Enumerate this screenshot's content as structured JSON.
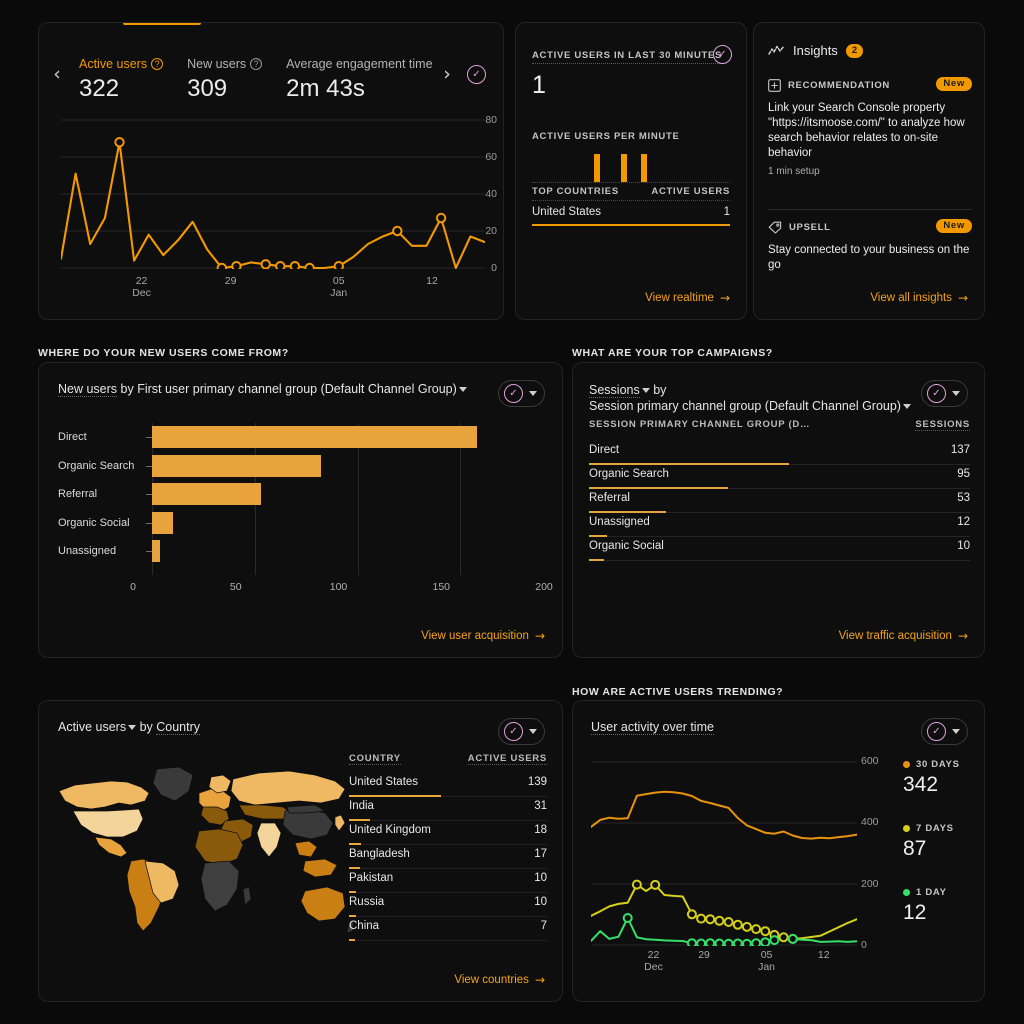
{
  "metrics_card": {
    "nav_prev": "‹",
    "nav_next": "›",
    "metrics": [
      {
        "label": "Active users",
        "value": "322",
        "active": true
      },
      {
        "label": "New users",
        "value": "309",
        "active": false
      },
      {
        "label": "Average engagement time ",
        "value": "2m 43s",
        "active": false
      }
    ],
    "check_icon": "check-circle-icon"
  },
  "realtime_card": {
    "kicker": "ACTIVE USERS IN LAST 30 MINUTES",
    "big_value": "1",
    "per_minute_label": "ACTIVE USERS PER MINUTE",
    "table_head_left": "TOP COUNTRIES",
    "table_head_right": "ACTIVE USERS",
    "row_country": "United States",
    "row_value": "1",
    "link": "View realtime"
  },
  "insights_card": {
    "title": "Insights",
    "count": "2",
    "items": [
      {
        "kicker": "RECOMMENDATION",
        "badge": "New",
        "body": "Link your Search Console property \"https://itsmoose.com/\" to analyze how search behavior relates to on-site behavior",
        "meta": "1 min setup",
        "icon": "plus-box-icon"
      },
      {
        "kicker": "UPSELL",
        "badge": "New",
        "body": "Stay connected to your business on the go",
        "meta": "",
        "icon": "tag-icon"
      }
    ],
    "link": "View all insights"
  },
  "new_users_card": {
    "section_title": "WHERE DO YOUR NEW USERS COME FROM?",
    "title_metric": "New users",
    "title_mid": " by ",
    "title_dim": "First user primary channel group (Default Channel Group)",
    "link": "View user acquisition"
  },
  "campaigns_card": {
    "section_title": "WHAT ARE YOUR TOP CAMPAIGNS?",
    "title_metric": "Sessions",
    "title_mid": " by",
    "title_dim": "Session primary channel group (Default Channel Group)",
    "col_left": "SESSION PRIMARY CHANNEL GROUP (D…",
    "col_right": "SESSIONS",
    "link": "View traffic acquisition"
  },
  "map_card": {
    "title_metric": "Active users",
    "title_mid": " by ",
    "title_dim": "Country",
    "col_left": "COUNTRY",
    "col_right": "ACTIVE USERS",
    "link": "View countries"
  },
  "trend_card": {
    "section_title": "HOW ARE ACTIVE USERS TRENDING?",
    "title": "User activity over time",
    "legend": [
      {
        "label": "30 DAYS",
        "value": "342",
        "color": "#e8920d"
      },
      {
        "label": "7 DAYS",
        "value": "87",
        "color": "#d6d018"
      },
      {
        "label": "1 DAY",
        "value": "12",
        "color": "#35e06a"
      }
    ]
  },
  "colors": {
    "accent": "#f29900",
    "bar": "#e8a33d",
    "check": "#e2a2de",
    "card_bg": "#0e0e0e",
    "page_bg": "#0a0a0a"
  },
  "chart_data": [
    {
      "type": "line",
      "id": "active-users-sparkline",
      "title": "Active users",
      "xlabel": "",
      "ylabel": "",
      "ylim": [
        0,
        80
      ],
      "yticks": [
        0,
        20,
        40,
        60,
        80
      ],
      "grid": true,
      "xtick_labels": [
        "22\nDec",
        "29",
        "05\nJan",
        "12"
      ],
      "xtick_positions": [
        0.19,
        0.4,
        0.655,
        0.875
      ],
      "series": [
        {
          "name": "Active users",
          "color": "#f29900",
          "values": [
            5,
            51,
            13,
            27,
            68,
            4,
            18,
            7,
            15,
            25,
            10,
            0,
            1,
            3,
            2,
            1,
            1,
            0,
            0,
            1,
            6,
            13,
            17,
            20,
            12,
            12,
            27,
            0,
            17,
            14
          ]
        }
      ]
    },
    {
      "type": "bar",
      "id": "active-users-per-minute",
      "title": "Active users per minute",
      "orientation": "vertical",
      "values": [
        0,
        0,
        0,
        0,
        0,
        0,
        0,
        0,
        0,
        1,
        0,
        0,
        1,
        0,
        1,
        0,
        0,
        0,
        0,
        0,
        0,
        0,
        0,
        0,
        0,
        0,
        0,
        0,
        0,
        0
      ],
      "bar_indices": [
        9,
        13,
        16
      ]
    },
    {
      "type": "bar",
      "id": "new-users-by-channel",
      "orientation": "horizontal",
      "title": "New users by First user primary channel group (Default Channel Group)",
      "categories": [
        "Direct",
        "Organic Search",
        "Referral",
        "Organic Social",
        "Unassigned"
      ],
      "values": [
        158,
        82,
        53,
        10,
        4
      ],
      "xlim": [
        0,
        200
      ],
      "xticks": [
        0,
        50,
        100,
        150,
        200
      ],
      "grid": true,
      "color": "#e8a33d"
    },
    {
      "type": "table",
      "id": "sessions-by-channel",
      "title": "Sessions by Session primary channel group (Default Channel Group)",
      "columns": [
        "SESSION PRIMARY CHANNEL GROUP (D…",
        "SESSIONS"
      ],
      "rows": [
        [
          "Direct",
          "137"
        ],
        [
          "Organic Search",
          "95"
        ],
        [
          "Referral",
          "53"
        ],
        [
          "Unassigned",
          "12"
        ],
        [
          "Organic Social",
          "10"
        ]
      ],
      "values": [
        137,
        95,
        53,
        12,
        10
      ],
      "max": 137
    },
    {
      "type": "table",
      "id": "active-users-by-country",
      "title": "Active users by Country",
      "columns": [
        "COUNTRY",
        "ACTIVE USERS"
      ],
      "rows": [
        [
          "United States",
          "139"
        ],
        [
          "India",
          "31"
        ],
        [
          "United Kingdom",
          "18"
        ],
        [
          "Bangladesh",
          "17"
        ],
        [
          "Pakistan",
          "10"
        ],
        [
          "Russia",
          "10"
        ],
        [
          "China",
          "7"
        ]
      ],
      "values": [
        139,
        31,
        18,
        17,
        10,
        10,
        7
      ],
      "max": 139
    },
    {
      "type": "line",
      "id": "user-activity-over-time",
      "title": "User activity over time",
      "ylim": [
        0,
        600
      ],
      "yticks": [
        0,
        200,
        400,
        600
      ],
      "grid": true,
      "xtick_labels": [
        "22\nDec",
        "29",
        "05\nJan",
        "12"
      ],
      "xtick_positions": [
        0.235,
        0.425,
        0.66,
        0.875
      ],
      "series": [
        {
          "name": "30 DAYS",
          "color": "#e8920d",
          "current": 342,
          "values": [
            385,
            408,
            415,
            412,
            413,
            487,
            492,
            497,
            500,
            498,
            494,
            486,
            470,
            463,
            455,
            447,
            414,
            390,
            378,
            366,
            363,
            370,
            357,
            349,
            347,
            350,
            348,
            352,
            355,
            360
          ]
        },
        {
          "name": "7 DAYS",
          "color": "#d6d018",
          "current": 87,
          "values": [
            95,
            110,
            126,
            134,
            138,
            197,
            176,
            196,
            163,
            160,
            158,
            100,
            86,
            84,
            79,
            75,
            66,
            59,
            52,
            45,
            33,
            25,
            20,
            22,
            26,
            30,
            44,
            58,
            72,
            84
          ]
        },
        {
          "name": "1 DAY",
          "color": "#35e06a",
          "current": 12,
          "values": [
            13,
            45,
            20,
            27,
            88,
            25,
            19,
            17,
            15,
            14,
            13,
            6,
            5,
            6,
            5,
            4,
            5,
            4,
            6,
            9,
            16,
            28,
            20,
            17,
            16,
            10,
            11,
            12,
            10,
            12
          ]
        }
      ]
    }
  ]
}
